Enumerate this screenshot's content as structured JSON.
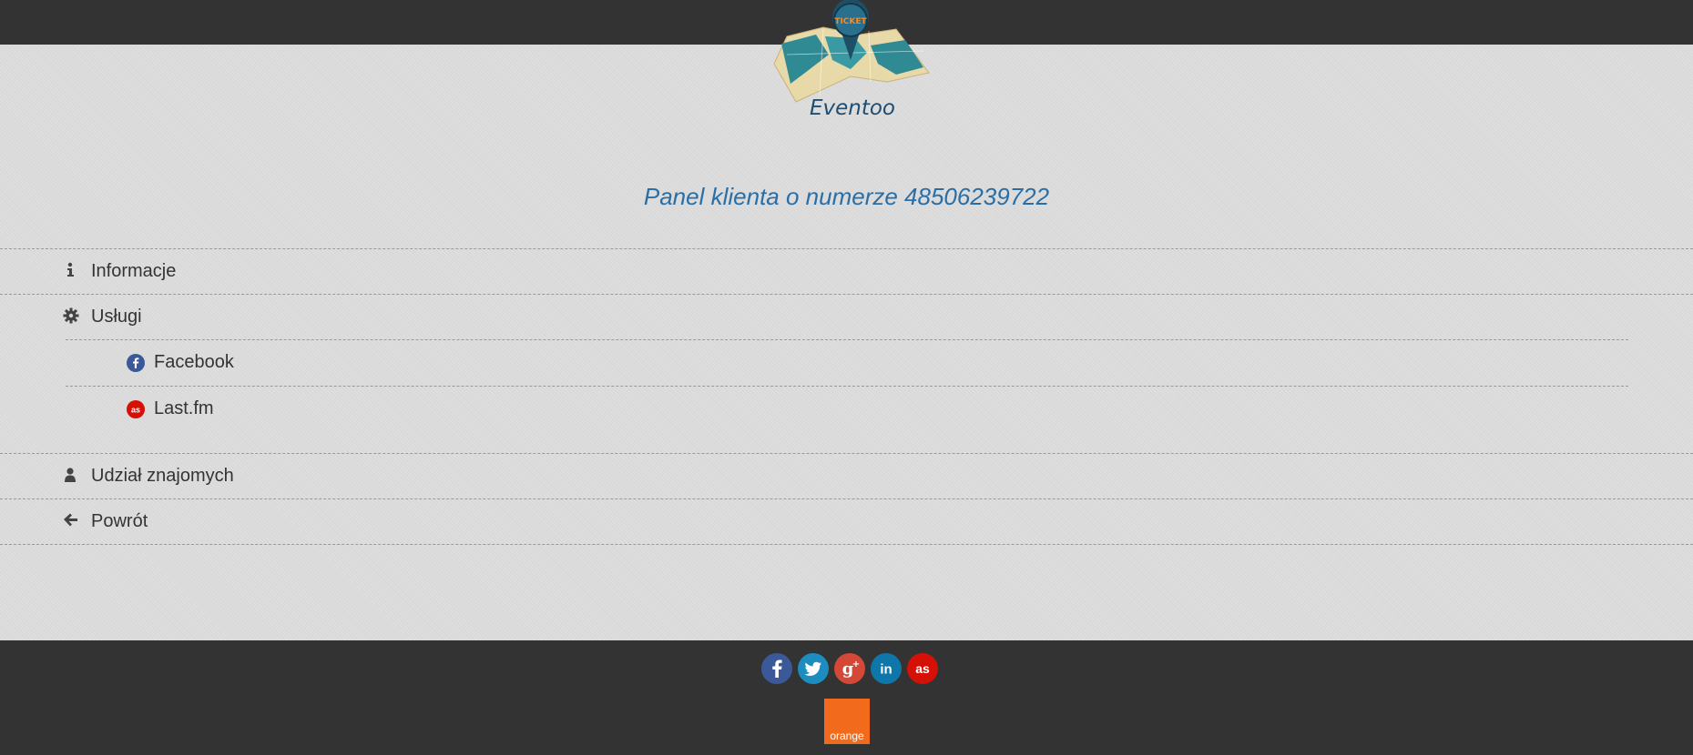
{
  "brand": {
    "name": "Eventoo",
    "pin_label": "TICKET"
  },
  "panel": {
    "title": "Panel klienta o numerze 48506239722"
  },
  "menu": {
    "items": [
      {
        "label": "Informacje",
        "icon": "info-icon"
      },
      {
        "label": "Usługi",
        "icon": "gear-icon"
      },
      {
        "label": "Udział znajomych",
        "icon": "user-icon"
      },
      {
        "label": "Powrót",
        "icon": "arrow-left-icon"
      }
    ],
    "services": [
      {
        "label": "Facebook",
        "icon": "facebook-icon",
        "color": "#3b5998"
      },
      {
        "label": "Last.fm",
        "icon": "lastfm-icon",
        "color": "#d51007"
      }
    ]
  },
  "footer": {
    "socials": [
      {
        "name": "facebook-icon",
        "glyph": "f",
        "color": "#3b5998"
      },
      {
        "name": "twitter-icon",
        "glyph": "t",
        "color": "#1d8dc0"
      },
      {
        "name": "google-plus-icon",
        "glyph": "g+",
        "color": "#d34836"
      },
      {
        "name": "linkedin-icon",
        "glyph": "in",
        "color": "#0e76a8"
      },
      {
        "name": "lastfm-icon",
        "glyph": "as",
        "color": "#d51007"
      }
    ],
    "partner": {
      "label": "orange",
      "color": "#f26b1d"
    }
  },
  "colors": {
    "bar": "#333333",
    "accent": "#2a6ea6",
    "background": "#d9d9d9"
  }
}
